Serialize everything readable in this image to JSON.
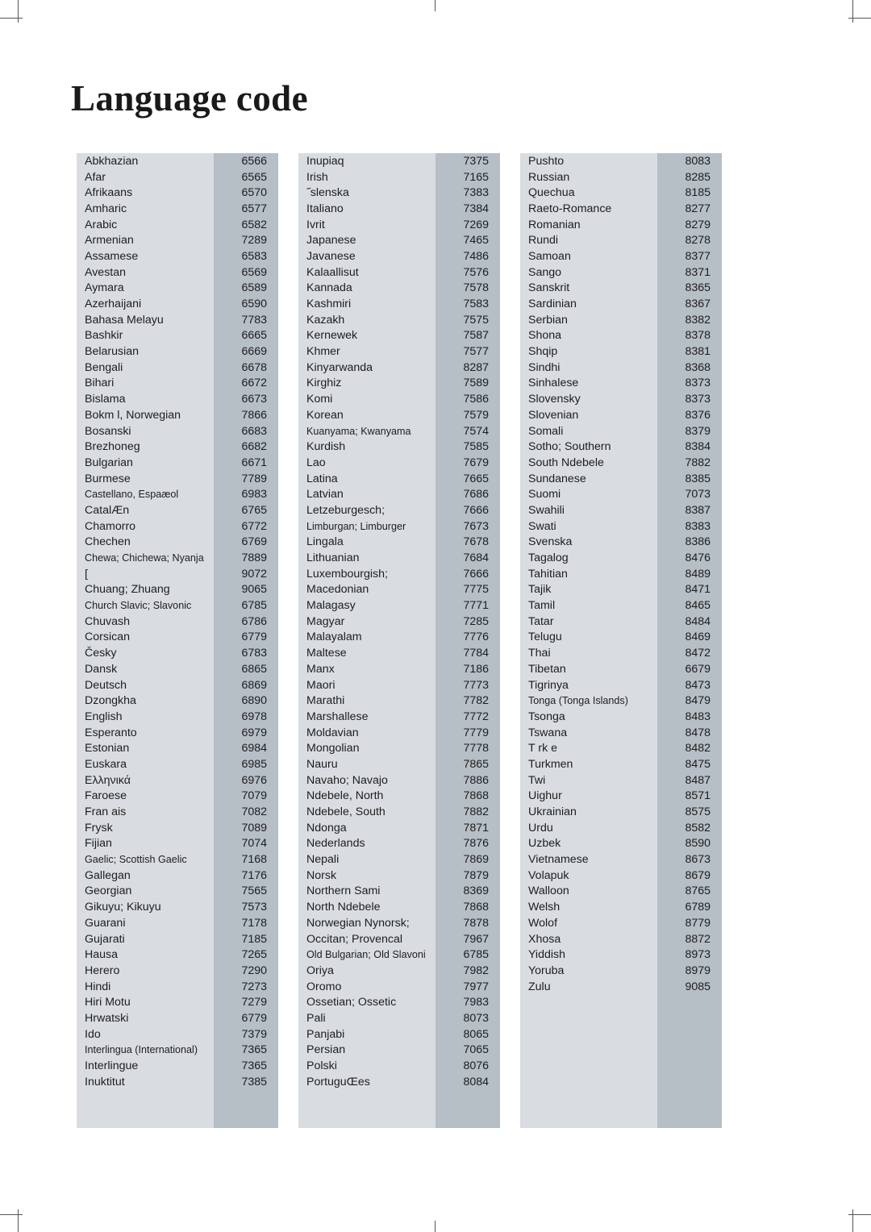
{
  "page": {
    "title": "Language code"
  },
  "columns": [
    {
      "id": "column-1",
      "rows": [
        {
          "name": "Abkhazian",
          "code": "6566"
        },
        {
          "name": "Afar",
          "code": "6565"
        },
        {
          "name": "Afrikaans",
          "code": "6570"
        },
        {
          "name": "Amharic",
          "code": "6577"
        },
        {
          "name": "Arabic",
          "code": "6582"
        },
        {
          "name": "Armenian",
          "code": "7289"
        },
        {
          "name": "Assamese",
          "code": "6583"
        },
        {
          "name": "Avestan",
          "code": "6569"
        },
        {
          "name": "Aymara",
          "code": "6589"
        },
        {
          "name": "Azerhaijani",
          "code": "6590"
        },
        {
          "name": "Bahasa Melayu",
          "code": "7783"
        },
        {
          "name": "Bashkir",
          "code": "6665"
        },
        {
          "name": "Belarusian",
          "code": "6669"
        },
        {
          "name": "Bengali",
          "code": "6678"
        },
        {
          "name": "Bihari",
          "code": "6672"
        },
        {
          "name": "Bislama",
          "code": "6673"
        },
        {
          "name": "Bokm l, Norwegian",
          "code": "7866"
        },
        {
          "name": "Bosanski",
          "code": "6683"
        },
        {
          "name": "Brezhoneg",
          "code": "6682"
        },
        {
          "name": "Bulgarian",
          "code": "6671"
        },
        {
          "name": "Burmese",
          "code": "7789"
        },
        {
          "name": "Castellano, Espaæol",
          "code": "6983",
          "wide": true
        },
        {
          "name": "CatalÆn",
          "code": "6765"
        },
        {
          "name": "Chamorro",
          "code": "6772"
        },
        {
          "name": "Chechen",
          "code": "6769"
        },
        {
          "name": "Chewa; Chichewa; Nyanja",
          "code": "7889",
          "wide": true
        },
        {
          "name": "[",
          "code": "9072"
        },
        {
          "name": "Chuang; Zhuang",
          "code": "9065"
        },
        {
          "name": "Church Slavic; Slavonic",
          "code": "6785",
          "wide": true
        },
        {
          "name": "Chuvash",
          "code": "6786"
        },
        {
          "name": "Corsican",
          "code": "6779"
        },
        {
          "name": "Česky",
          "code": "6783"
        },
        {
          "name": "Dansk",
          "code": "6865"
        },
        {
          "name": "Deutsch",
          "code": "6869"
        },
        {
          "name": "Dzongkha",
          "code": "6890"
        },
        {
          "name": "English",
          "code": "6978"
        },
        {
          "name": "Esperanto",
          "code": "6979"
        },
        {
          "name": "Estonian",
          "code": "6984"
        },
        {
          "name": "Euskara",
          "code": "6985"
        },
        {
          "name": "Ελληνικά",
          "code": "6976"
        },
        {
          "name": "Faroese",
          "code": "7079"
        },
        {
          "name": "Fran ais",
          "code": "7082"
        },
        {
          "name": "Frysk",
          "code": "7089"
        },
        {
          "name": "Fijian",
          "code": "7074"
        },
        {
          "name": "Gaelic; Scottish Gaelic",
          "code": "7168",
          "wide": true
        },
        {
          "name": "Gallegan",
          "code": "7176"
        },
        {
          "name": "Georgian",
          "code": "7565"
        },
        {
          "name": "Gikuyu; Kikuyu",
          "code": "7573"
        },
        {
          "name": "Guarani",
          "code": "7178"
        },
        {
          "name": "Gujarati",
          "code": "7185"
        },
        {
          "name": "Hausa",
          "code": "7265"
        },
        {
          "name": "Herero",
          "code": "7290"
        },
        {
          "name": "Hindi",
          "code": "7273"
        },
        {
          "name": "Hiri Motu",
          "code": "7279"
        },
        {
          "name": "Hrwatski",
          "code": "6779"
        },
        {
          "name": "Ido",
          "code": "7379"
        },
        {
          "name": "Interlingua (International)",
          "code": "7365",
          "wide": true
        },
        {
          "name": "Interlingue",
          "code": "7365"
        },
        {
          "name": "Inuktitut",
          "code": "7385"
        }
      ]
    },
    {
      "id": "column-2",
      "rows": [
        {
          "name": "Inupiaq",
          "code": "7375"
        },
        {
          "name": "Irish",
          "code": "7165"
        },
        {
          "name": "˝slenska",
          "code": "7383"
        },
        {
          "name": "Italiano",
          "code": "7384"
        },
        {
          "name": "Ivrit",
          "code": "7269"
        },
        {
          "name": "Japanese",
          "code": "7465"
        },
        {
          "name": "Javanese",
          "code": "7486"
        },
        {
          "name": "Kalaallisut",
          "code": "7576"
        },
        {
          "name": "Kannada",
          "code": "7578"
        },
        {
          "name": "Kashmiri",
          "code": "7583"
        },
        {
          "name": "Kazakh",
          "code": "7575"
        },
        {
          "name": "Kernewek",
          "code": "7587"
        },
        {
          "name": "Khmer",
          "code": "7577"
        },
        {
          "name": "Kinyarwanda",
          "code": "8287"
        },
        {
          "name": "Kirghiz",
          "code": "7589"
        },
        {
          "name": "Komi",
          "code": "7586"
        },
        {
          "name": "Korean",
          "code": "7579"
        },
        {
          "name": "Kuanyama; Kwanyama",
          "code": "7574",
          "wide": true
        },
        {
          "name": "Kurdish",
          "code": "7585"
        },
        {
          "name": "Lao",
          "code": "7679"
        },
        {
          "name": "Latina",
          "code": "7665"
        },
        {
          "name": "Latvian",
          "code": "7686"
        },
        {
          "name": "Letzeburgesch;",
          "code": "7666"
        },
        {
          "name": "Limburgan; Limburger",
          "code": "7673",
          "wide": true
        },
        {
          "name": "Lingala",
          "code": "7678"
        },
        {
          "name": "Lithuanian",
          "code": "7684"
        },
        {
          "name": "Luxembourgish;",
          "code": "7666"
        },
        {
          "name": "Macedonian",
          "code": "7775"
        },
        {
          "name": "Malagasy",
          "code": "7771"
        },
        {
          "name": "Magyar",
          "code": "7285"
        },
        {
          "name": "Malayalam",
          "code": "7776"
        },
        {
          "name": "Maltese",
          "code": "7784"
        },
        {
          "name": "Manx",
          "code": "7186"
        },
        {
          "name": "Maori",
          "code": "7773"
        },
        {
          "name": "Marathi",
          "code": "7782"
        },
        {
          "name": "Marshallese",
          "code": "7772"
        },
        {
          "name": "Moldavian",
          "code": "7779"
        },
        {
          "name": "Mongolian",
          "code": "7778"
        },
        {
          "name": "Nauru",
          "code": "7865"
        },
        {
          "name": "Navaho; Navajo",
          "code": "7886"
        },
        {
          "name": "Ndebele, North",
          "code": "7868"
        },
        {
          "name": "Ndebele, South",
          "code": "7882"
        },
        {
          "name": "Ndonga",
          "code": "7871"
        },
        {
          "name": "Nederlands",
          "code": "7876"
        },
        {
          "name": "Nepali",
          "code": "7869"
        },
        {
          "name": "Norsk",
          "code": "7879"
        },
        {
          "name": "Northern Sami",
          "code": "8369"
        },
        {
          "name": "North Ndebele",
          "code": "7868"
        },
        {
          "name": "Norwegian Nynorsk;",
          "code": "7878"
        },
        {
          "name": "Occitan; Provencal",
          "code": "7967"
        },
        {
          "name": "Old Bulgarian; Old Slavoni",
          "code": "6785",
          "wide": true
        },
        {
          "name": "Oriya",
          "code": "7982"
        },
        {
          "name": "Oromo",
          "code": "7977"
        },
        {
          "name": "Ossetian; Ossetic",
          "code": "7983"
        },
        {
          "name": "Pali",
          "code": "8073"
        },
        {
          "name": "Panjabi",
          "code": "8065"
        },
        {
          "name": "Persian",
          "code": "7065"
        },
        {
          "name": "Polski",
          "code": "8076"
        },
        {
          "name": "PortuguŒes",
          "code": "8084"
        }
      ]
    },
    {
      "id": "column-3",
      "rows": [
        {
          "name": "Pushto",
          "code": "8083"
        },
        {
          "name": "Russian",
          "code": "8285"
        },
        {
          "name": "Quechua",
          "code": "8185"
        },
        {
          "name": "Raeto-Romance",
          "code": "8277"
        },
        {
          "name": "Romanian",
          "code": "8279"
        },
        {
          "name": "Rundi",
          "code": "8278"
        },
        {
          "name": "Samoan",
          "code": "8377"
        },
        {
          "name": "Sango",
          "code": "8371"
        },
        {
          "name": "Sanskrit",
          "code": "8365"
        },
        {
          "name": "Sardinian",
          "code": "8367"
        },
        {
          "name": "Serbian",
          "code": "8382"
        },
        {
          "name": "Shona",
          "code": "8378"
        },
        {
          "name": "Shqip",
          "code": "8381"
        },
        {
          "name": "Sindhi",
          "code": "8368"
        },
        {
          "name": "Sinhalese",
          "code": "8373"
        },
        {
          "name": "Slovensky",
          "code": "8373"
        },
        {
          "name": "Slovenian",
          "code": "8376"
        },
        {
          "name": "Somali",
          "code": "8379"
        },
        {
          "name": "Sotho; Southern",
          "code": "8384"
        },
        {
          "name": "South Ndebele",
          "code": "7882"
        },
        {
          "name": "Sundanese",
          "code": "8385"
        },
        {
          "name": "Suomi",
          "code": "7073"
        },
        {
          "name": "Swahili",
          "code": "8387"
        },
        {
          "name": "Swati",
          "code": "8383"
        },
        {
          "name": "Svenska",
          "code": "8386"
        },
        {
          "name": "Tagalog",
          "code": "8476"
        },
        {
          "name": "Tahitian",
          "code": "8489"
        },
        {
          "name": "Tajik",
          "code": "8471"
        },
        {
          "name": "Tamil",
          "code": "8465"
        },
        {
          "name": "Tatar",
          "code": "8484"
        },
        {
          "name": "Telugu",
          "code": "8469"
        },
        {
          "name": "Thai",
          "code": "8472"
        },
        {
          "name": "Tibetan",
          "code": "6679"
        },
        {
          "name": "Tigrinya",
          "code": "8473"
        },
        {
          "name": "Tonga (Tonga Islands)",
          "code": "8479",
          "wide": true
        },
        {
          "name": "Tsonga",
          "code": "8483"
        },
        {
          "name": "Tswana",
          "code": "8478"
        },
        {
          "name": "T rk e",
          "code": "8482"
        },
        {
          "name": "Turkmen",
          "code": "8475"
        },
        {
          "name": "Twi",
          "code": "8487"
        },
        {
          "name": "Uighur",
          "code": "8571"
        },
        {
          "name": "Ukrainian",
          "code": "8575"
        },
        {
          "name": "Urdu",
          "code": "8582"
        },
        {
          "name": "Uzbek",
          "code": "8590"
        },
        {
          "name": "Vietnamese",
          "code": "8673"
        },
        {
          "name": "Volapuk",
          "code": "8679"
        },
        {
          "name": "Walloon",
          "code": "8765"
        },
        {
          "name": "Welsh",
          "code": "6789"
        },
        {
          "name": "Wolof",
          "code": "8779"
        },
        {
          "name": "Xhosa",
          "code": "8872"
        },
        {
          "name": "Yiddish",
          "code": "8973"
        },
        {
          "name": "Yoruba",
          "code": "8979"
        },
        {
          "name": "Zulu",
          "code": "9085"
        }
      ]
    }
  ],
  "layout": {
    "total_rows": 60,
    "colors": {
      "name_cell_bg": "#d9dde1",
      "code_cell_bg": "#b6bec6",
      "page_bg": "#ffffff",
      "text": "#1d1d1d"
    }
  }
}
